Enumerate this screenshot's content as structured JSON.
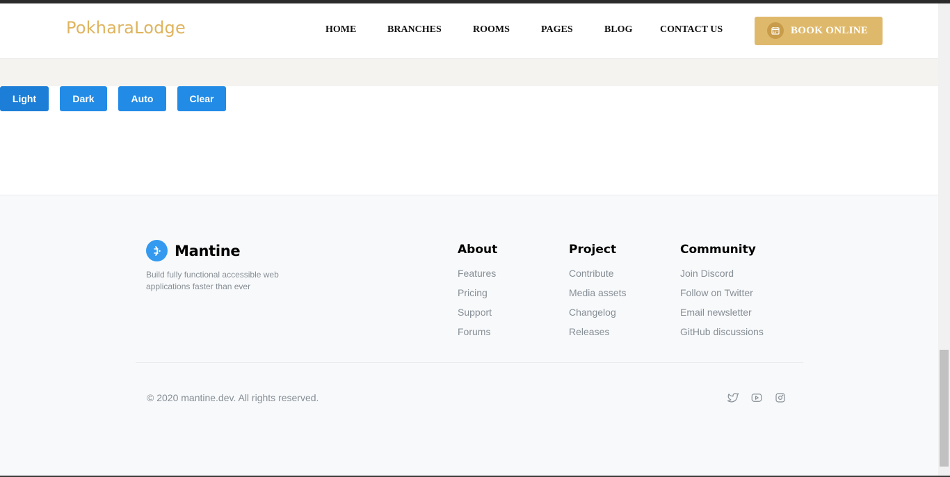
{
  "header": {
    "logo": "PokharaLodge",
    "nav": [
      {
        "label": "HOME",
        "name": "nav-home"
      },
      {
        "label": "BRANCHES",
        "name": "nav-branches"
      },
      {
        "label": "ROOMS",
        "name": "nav-rooms"
      },
      {
        "label": "PAGES",
        "name": "nav-pages"
      },
      {
        "label": "BLOG",
        "name": "nav-blog"
      },
      {
        "label": "CONTACT US",
        "name": "nav-contact-us"
      }
    ],
    "book_button": {
      "label": "BOOK ONLINE",
      "icon": "calendar-icon"
    }
  },
  "theme_buttons": [
    {
      "label": "Light"
    },
    {
      "label": "Dark"
    },
    {
      "label": "Auto"
    },
    {
      "label": "Clear"
    }
  ],
  "footer": {
    "brand": {
      "name": "Mantine",
      "icon": "mantine-logo-icon"
    },
    "tagline": "Build fully functional accessible web applications faster than ever",
    "columns": [
      {
        "title": "About",
        "links": [
          "Features",
          "Pricing",
          "Support",
          "Forums"
        ]
      },
      {
        "title": "Project",
        "links": [
          "Contribute",
          "Media assets",
          "Changelog",
          "Releases"
        ]
      },
      {
        "title": "Community",
        "links": [
          "Join Discord",
          "Follow on Twitter",
          "Email newsletter",
          "GitHub discussions"
        ]
      }
    ],
    "copyright": "© 2020 mantine.dev. All rights reserved.",
    "social": [
      "twitter-icon",
      "youtube-icon",
      "instagram-icon"
    ]
  },
  "colors": {
    "logo_gold": "#dfb45f",
    "book_button": "#dfb96b",
    "mantine_blue": "#228be6",
    "footer_bg": "#f8f9fa",
    "link_gray": "#868e96"
  }
}
